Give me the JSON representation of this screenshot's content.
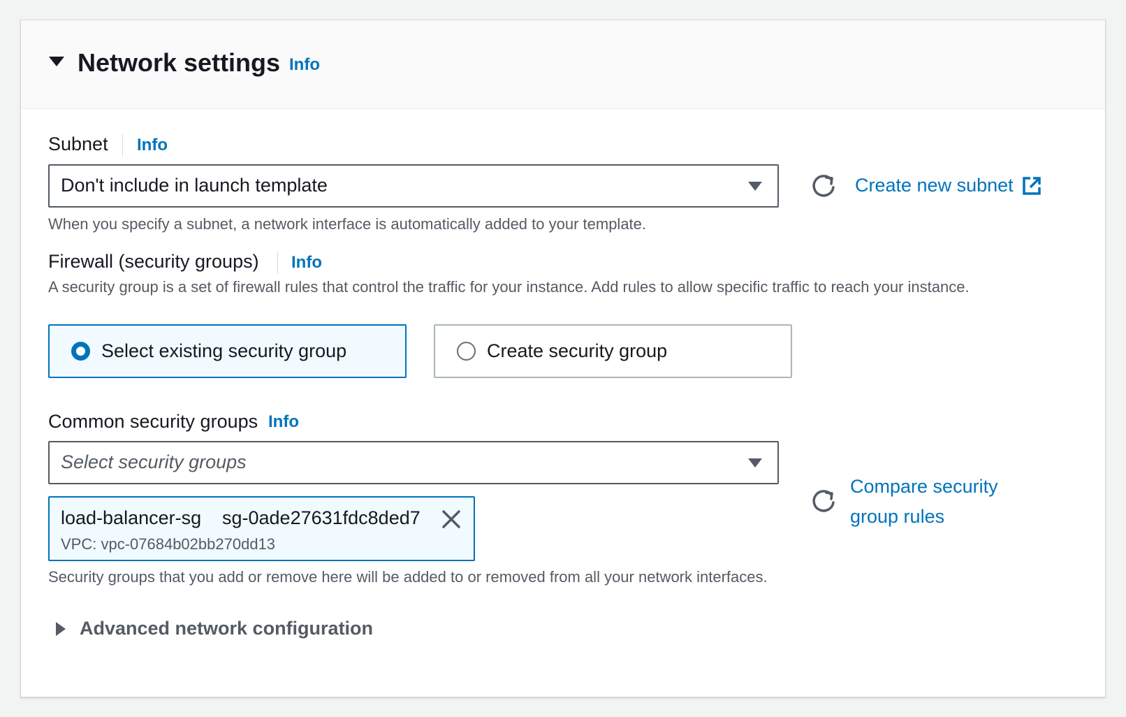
{
  "header": {
    "title": "Network settings",
    "info": "Info"
  },
  "subnet": {
    "label": "Subnet",
    "info": "Info",
    "selected_value": "Don't include in launch template",
    "create_link": "Create new subnet",
    "description": "When you specify a subnet, a network interface is automatically added to your template."
  },
  "firewall": {
    "label": "Firewall (security groups)",
    "info": "Info",
    "description": "A security group is a set of firewall rules that control the traffic for your instance. Add rules to allow specific traffic to reach your instance.",
    "options": [
      {
        "label": "Select existing security group",
        "selected": true
      },
      {
        "label": "Create security group",
        "selected": false
      }
    ]
  },
  "common_sg": {
    "label": "Common security groups",
    "info": "Info",
    "placeholder": "Select security groups",
    "compare_link": "Compare security group rules",
    "token": {
      "name": "load-balancer-sg",
      "id": "sg-0ade27631fdc8ded7",
      "vpc": "VPC: vpc-07684b02bb270dd13"
    },
    "description": "Security groups that you add or remove here will be added to or removed from all your network interfaces."
  },
  "advanced": {
    "label": "Advanced network configuration"
  },
  "icons": {
    "collapse": "caret-down-icon",
    "expand": "caret-right-icon",
    "refresh": "refresh-icon",
    "external": "external-link-icon",
    "dropdown": "chevron-down-icon",
    "remove": "close-icon"
  },
  "colors": {
    "link": "#0073bb",
    "selected_bg": "#f1faff",
    "text": "#16191f",
    "secondary_text": "#545b64"
  }
}
